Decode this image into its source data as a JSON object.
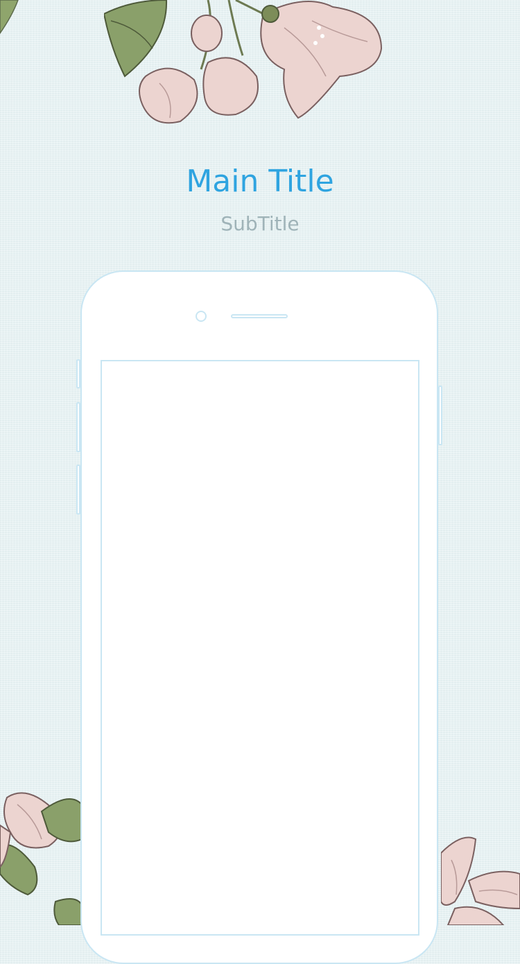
{
  "header": {
    "title": "Main Title",
    "subtitle": "SubTitle"
  },
  "colors": {
    "background": "#e6f1f2",
    "title": "#2fa4e0",
    "subtitle": "#9fb3b8",
    "phone_outline": "#c9e6f3",
    "petal": "#ecd4d0",
    "petal_edge": "#7a6060",
    "leaf": "#8aa06a"
  },
  "icons": {
    "decoration": "cherry-blossom-illustration",
    "device": "smartphone-outline"
  }
}
